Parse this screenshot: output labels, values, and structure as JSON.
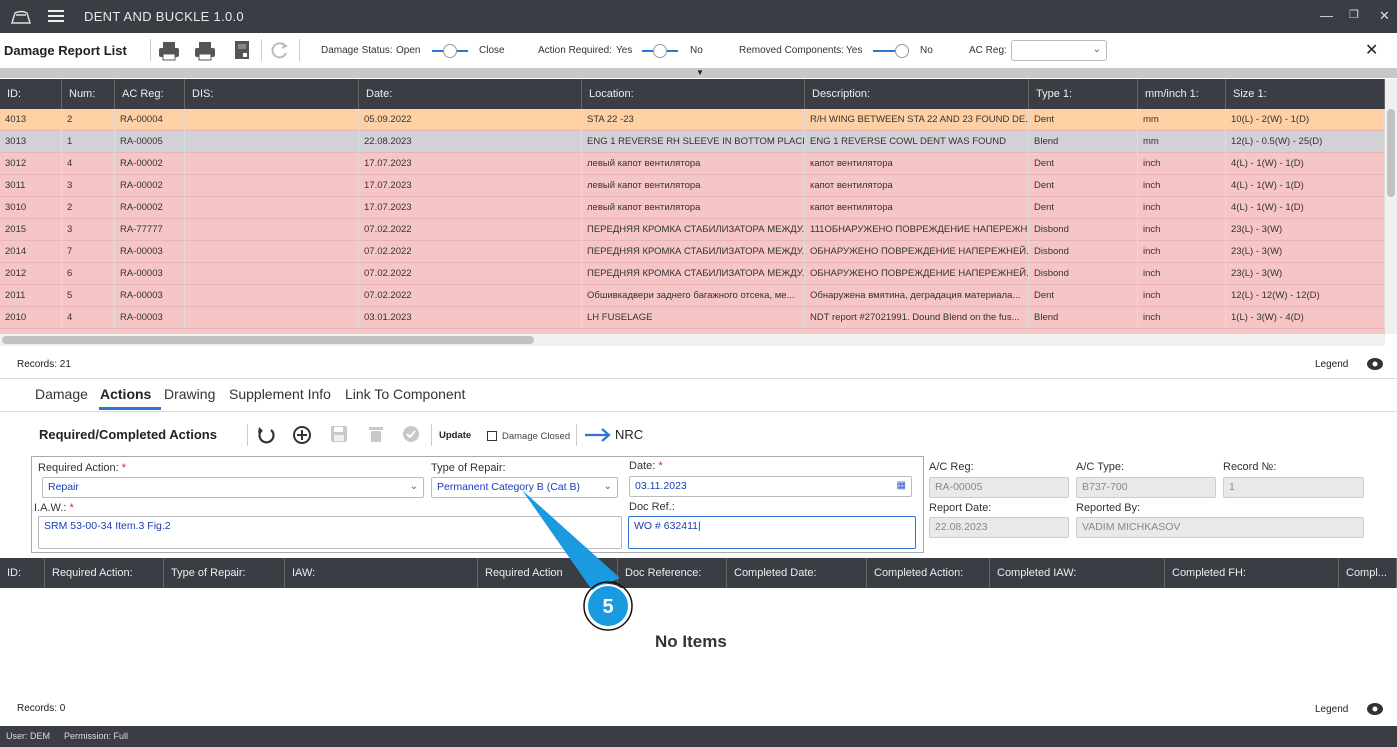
{
  "app": {
    "title": "DENT AND BUCKLE 1.0.0"
  },
  "toolbar": {
    "title": "Damage Report List",
    "damage_status": {
      "label": "Damage Status:",
      "left": "Open",
      "right": "Close"
    },
    "action_required": {
      "label": "Action Required:",
      "left": "Yes",
      "right": "No"
    },
    "removed_components": {
      "label": "Removed Components:",
      "left": "Yes",
      "right": "No"
    },
    "ac_reg": {
      "label": "AC Reg:",
      "value": ""
    }
  },
  "grid": {
    "columns": [
      "ID:",
      "Num:",
      "AC Reg:",
      "DIS:",
      "Date:",
      "Location:",
      "Description:",
      "Type 1:",
      "mm/inch 1:",
      "Size 1:"
    ],
    "rows": [
      [
        "4013",
        "2",
        "RA-00004",
        "",
        "05.09.2022",
        "STA 22 -23",
        "R/H WING BETWEEN STA 22 AND 23 FOUND DE...",
        "Dent",
        "mm",
        "10(L) - 2(W) - 1(D)"
      ],
      [
        "3013",
        "1",
        "RA-00005",
        "",
        "22.08.2023",
        "ENG 1 REVERSE RH SLEEVE IN BOTTOM PLACE...",
        "ENG 1 REVERSE COWL DENT WAS FOUND",
        "Blend",
        "mm",
        "12(L) - 0.5(W) - 25(D)"
      ],
      [
        "3012",
        "4",
        "RA-00002",
        "",
        "17.07.2023",
        "левый капот вентилятора",
        "капот вентилятора",
        "Dent",
        "inch",
        "4(L) - 1(W) - 1(D)"
      ],
      [
        "3011",
        "3",
        "RA-00002",
        "",
        "17.07.2023",
        "левый капот вентилятора",
        "капот вентилятора",
        "Dent",
        "inch",
        "4(L) - 1(W) - 1(D)"
      ],
      [
        "3010",
        "2",
        "RA-00002",
        "",
        "17.07.2023",
        "левый капот вентилятора",
        "капот вентилятора",
        "Dent",
        "inch",
        "4(L) - 1(W) - 1(D)"
      ],
      [
        "2015",
        "3",
        "RA-77777",
        "",
        "07.02.2022",
        "ПЕРЕДНЯЯ КРОМКА СТАБИЛИЗАТОРА МЕЖДУ...",
        "111ОБНАРУЖЕНО ПОВРЕЖДЕНИЕ НАПЕРЕЖН...",
        "Disbond",
        "inch",
        "23(L) - 3(W)"
      ],
      [
        "2014",
        "7",
        "RA-00003",
        "",
        "07.02.2022",
        "ПЕРЕДНЯЯ КРОМКА СТАБИЛИЗАТОРА МЕЖДУ...",
        "ОБНАРУЖЕНО ПОВРЕЖДЕНИЕ НАПЕРЕЖНЕЙ...",
        "Disbond",
        "inch",
        "23(L) - 3(W)"
      ],
      [
        "2012",
        "6",
        "RA-00003",
        "",
        "07.02.2022",
        "ПЕРЕДНЯЯ КРОМКА СТАБИЛИЗАТОРА МЕЖДУ...",
        "ОБНАРУЖЕНО ПОВРЕЖДЕНИЕ НАПЕРЕЖНЕЙ...",
        "Disbond",
        "inch",
        "23(L) - 3(W)"
      ],
      [
        "2011",
        "5",
        "RA-00003",
        "",
        "07.02.2022",
        "Обшивкадвери заднего багажного отсека, ме...",
        "Обнаружена вмятина,  деградация материала...",
        "Dent",
        "inch",
        "12(L) - 12(W) - 12(D)"
      ],
      [
        "2010",
        "4",
        "RA-00003",
        "",
        "03.01.2023",
        "LH FUSELAGE",
        "NDT report #27021991. Dound Blend on the fus...",
        "Blend",
        "inch",
        "1(L) - 3(W) - 4(D)"
      ]
    ],
    "row_colors": [
      "#ffd0a4",
      "#d2d1d5",
      "#f6c6c6"
    ],
    "records": "Records: 21",
    "legend": "Legend"
  },
  "tabs": [
    "Damage",
    "Actions",
    "Drawing",
    "Supplement Info",
    "Link To Component"
  ],
  "actions": {
    "title": "Required/Completed Actions",
    "update": "Update",
    "damage_closed": "Damage Closed",
    "nrc": "NRC",
    "required_action": {
      "label": "Required Action:",
      "value": "Repair"
    },
    "type_of_repair": {
      "label": "Type of Repair:",
      "value": "Permanent Category B (Cat B)"
    },
    "date": {
      "label": "Date:",
      "value": "03.11.2023"
    },
    "iaw": {
      "label": "I.A.W.:",
      "value": "SRM 53-00-34 Item.3 Fig.2"
    },
    "doc_ref": {
      "label": "Doc Ref.:",
      "value": "WO # 632411"
    },
    "ac_reg": {
      "label": "A/C Reg:",
      "value": "RA-00005"
    },
    "ac_type": {
      "label": "A/C Type:",
      "value": "B737-700"
    },
    "record_no": {
      "label": "Record №:",
      "value": "1"
    },
    "report_date": {
      "label": "Report Date:",
      "value": "22.08.2023"
    },
    "reported_by": {
      "label": "Reported By:",
      "value": "VADIM MICHKASOV"
    }
  },
  "actions_grid": {
    "columns": [
      "ID:",
      "Required Action:",
      "Type of Repair:",
      "IAW:",
      "Required Action",
      "Doc Reference:",
      "Completed Date:",
      "Completed Action:",
      "Completed IAW:",
      "Completed FH:",
      "Compl..."
    ],
    "empty": "No Items",
    "records": "Records: 0",
    "legend": "Legend"
  },
  "callout": {
    "number": "5",
    "color": "#1a9be0"
  },
  "status": {
    "user": "User: DEM",
    "permission": "Permission: Full"
  }
}
